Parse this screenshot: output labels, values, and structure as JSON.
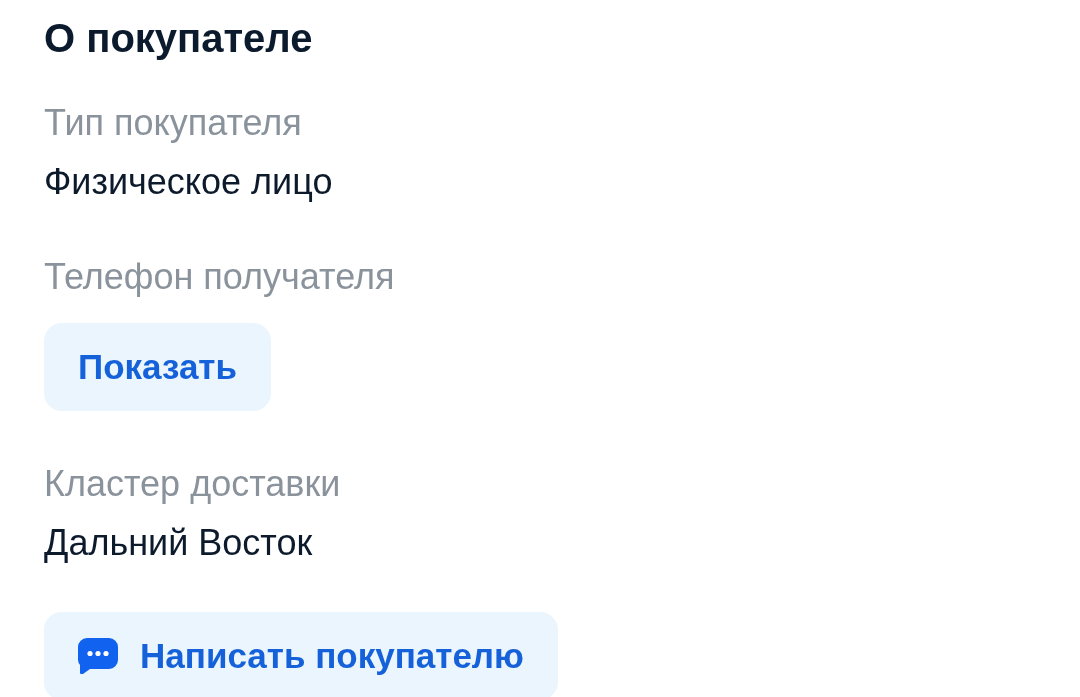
{
  "section": {
    "title": "О покупателе",
    "fields": [
      {
        "kind": "text",
        "label": "Тип покупателя",
        "value": "Физическое лицо"
      },
      {
        "kind": "button",
        "label": "Телефон получателя",
        "button": "Показать"
      },
      {
        "kind": "text",
        "label": "Кластер доставки",
        "value": "Дальний Восток"
      }
    ],
    "action": {
      "label": "Написать покупателю"
    }
  }
}
